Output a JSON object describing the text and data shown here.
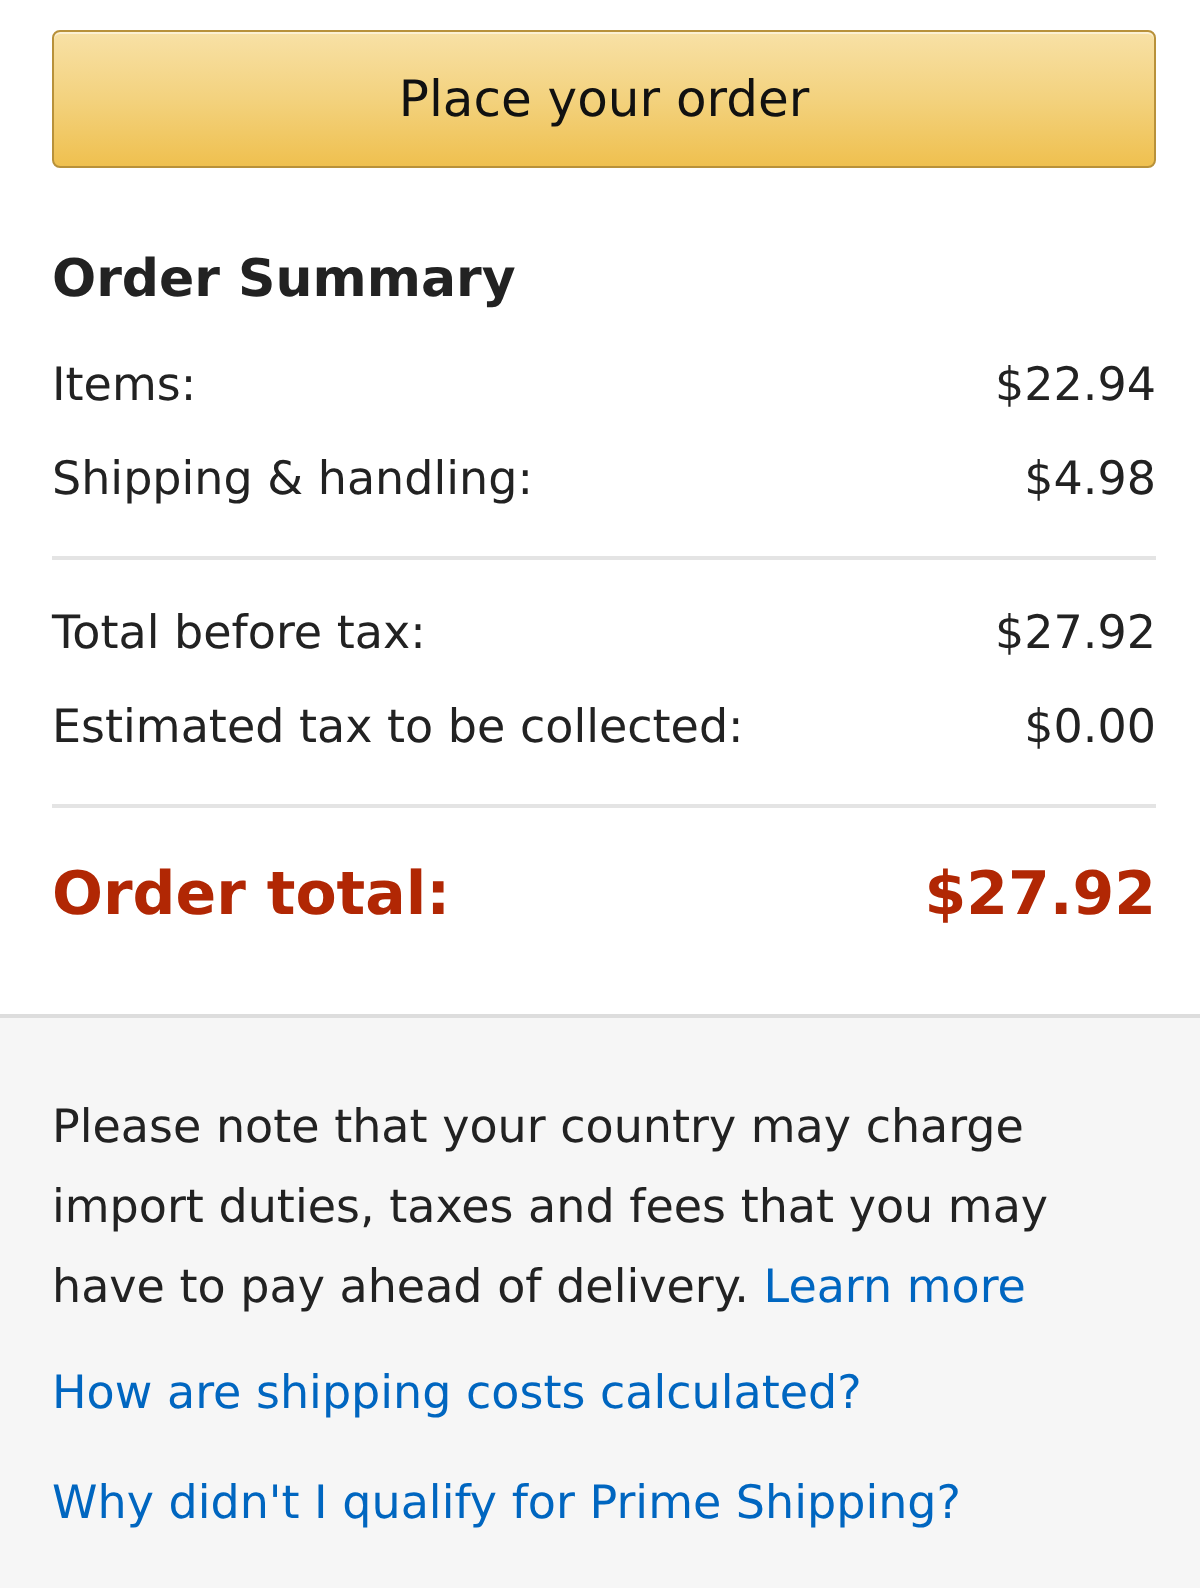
{
  "place_order_button": {
    "label": "Place your order"
  },
  "order_summary": {
    "title": "Order Summary",
    "groups": [
      {
        "rows": [
          {
            "label": "Items:",
            "value": "$22.94"
          },
          {
            "label": "Shipping & handling:",
            "value": "$4.98"
          }
        ]
      },
      {
        "rows": [
          {
            "label": "Total before tax:",
            "value": "$27.92"
          },
          {
            "label": "Estimated tax to be collected:",
            "value": "$0.00"
          }
        ]
      }
    ],
    "total": {
      "label": "Order total:",
      "value": "$27.92"
    }
  },
  "notice": {
    "text": "Please note that your country may charge import duties, taxes and fees that you may have to pay ahead of delivery.",
    "link": "Learn more"
  },
  "help_links": [
    "How are shipping costs calculated?",
    "Why didn't I qualify for Prime Shipping?"
  ]
}
